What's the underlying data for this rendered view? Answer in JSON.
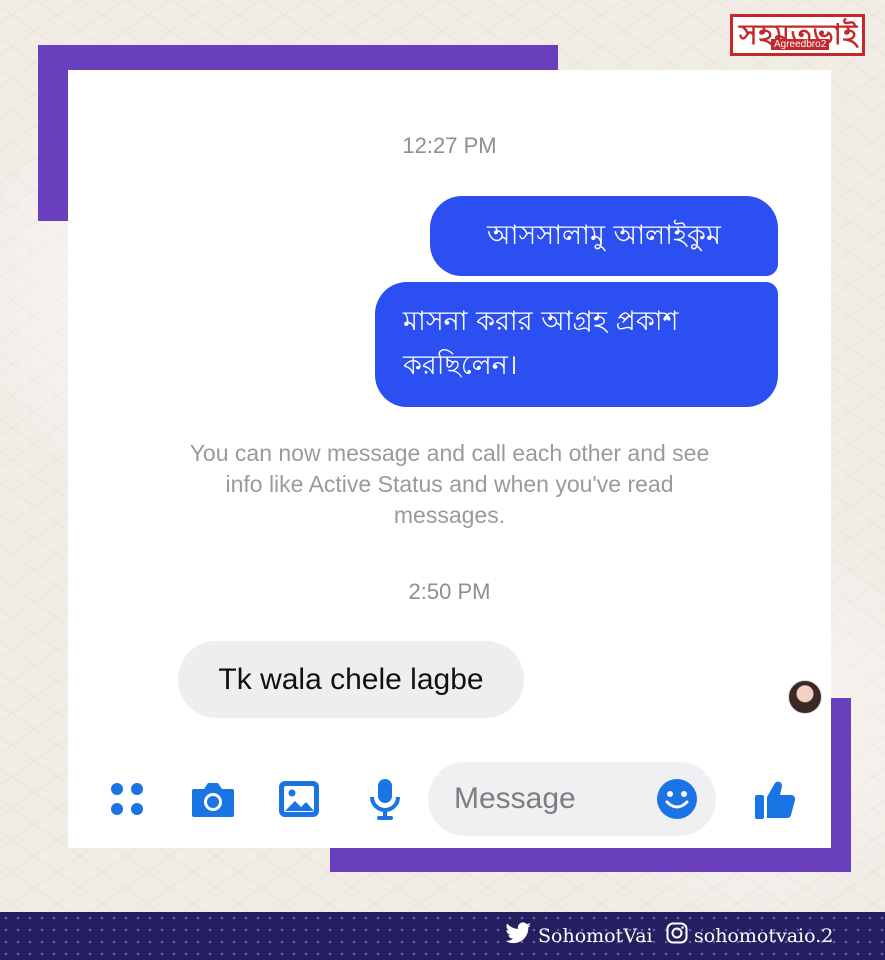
{
  "logo": {
    "main_text": "সহমতভাই",
    "sub_text": "Agreedbro2"
  },
  "chat": {
    "timestamp_1": "12:27 PM",
    "outgoing_1": "আসসালামু আলাইকুম",
    "outgoing_2": "মাসনা করার আগ্রহ প্রকাশ করছিলেন।",
    "system_message": "You can now message and call each other and see info like Active Status and when you've read messages.",
    "timestamp_2": "2:50 PM",
    "incoming_1": "Tk wala chele lagbe"
  },
  "composer": {
    "placeholder": "Message",
    "icons": [
      "apps-icon",
      "camera-icon",
      "gallery-icon",
      "microphone-icon",
      "emoji-icon",
      "thumbs-up-icon"
    ]
  },
  "footer": {
    "twitter_handle": "SohomotVai",
    "instagram_handle": "sohomotvaio.2"
  },
  "colors": {
    "frame": "#6a3fbe",
    "bubble_out": "#2b4ff0",
    "bubble_in": "#eeeef0",
    "icon_blue": "#1b74e4",
    "footer_bg": "#241f5e"
  }
}
